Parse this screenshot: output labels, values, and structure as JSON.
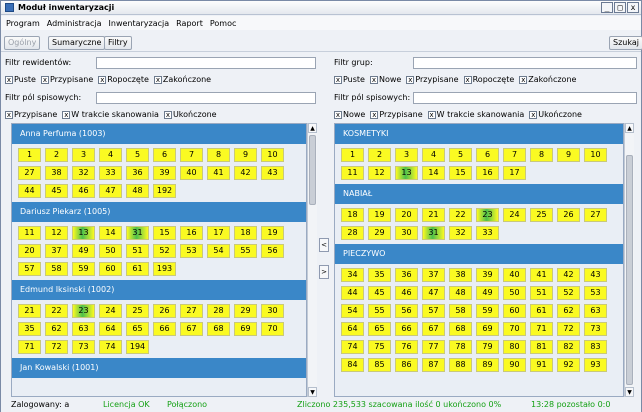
{
  "window": {
    "title": "Moduł inwentaryzacji",
    "controls": [
      "_",
      "□",
      "x"
    ]
  },
  "menu": [
    "Program",
    "Administracja",
    "Inwentaryzacja",
    "Raport",
    "Pomoc"
  ],
  "toolbar": {
    "ogolny": "Ogólny",
    "sumaryczne": "Sumaryczne",
    "filtry": "Filtry",
    "szukaj": "Szukaj"
  },
  "left_filters": {
    "reviewer_label": "Filtr rewidentów:",
    "reviewer_value": "",
    "status_checks": [
      "Puste",
      "Przypisane",
      "Ropoczęte",
      "Zakończone"
    ],
    "fields_label": "Filtr pól spisowych:",
    "fields_value": "",
    "field_checks": [
      "Przypisane",
      "W trakcie skanowania",
      "Ukończone"
    ]
  },
  "right_filters": {
    "group_label": "Filtr grup:",
    "group_value": "",
    "status_checks": [
      "Puste",
      "Nowe",
      "Przypisane",
      "Ropoczęte",
      "Zakończone"
    ],
    "fields_label": "Filtr pól spisowych:",
    "fields_value": "",
    "field_checks": [
      "Nowe",
      "Przypisane",
      "W trakcie skanowania",
      "Ukończone"
    ]
  },
  "checkbox_glyph": "x",
  "left_groups": [
    {
      "name": "Anna Perfuma (1003)",
      "cells": [
        {
          "n": "1"
        },
        {
          "n": "2"
        },
        {
          "n": "3"
        },
        {
          "n": "4"
        },
        {
          "n": "5"
        },
        {
          "n": "6"
        },
        {
          "n": "7"
        },
        {
          "n": "8"
        },
        {
          "n": "9"
        },
        {
          "n": "10"
        },
        {
          "n": "27"
        },
        {
          "n": "38"
        },
        {
          "n": "32"
        },
        {
          "n": "33"
        },
        {
          "n": "36"
        },
        {
          "n": "39"
        },
        {
          "n": "40"
        },
        {
          "n": "41"
        },
        {
          "n": "42"
        },
        {
          "n": "43"
        },
        {
          "n": "44"
        },
        {
          "n": "45"
        },
        {
          "n": "46"
        },
        {
          "n": "47"
        },
        {
          "n": "48"
        },
        {
          "n": "192"
        }
      ]
    },
    {
      "name": "Dariusz Piekarz (1005)",
      "cells": [
        {
          "n": "11"
        },
        {
          "n": "12"
        },
        {
          "n": "13",
          "done": true
        },
        {
          "n": "14"
        },
        {
          "n": "31",
          "done": true
        },
        {
          "n": "15"
        },
        {
          "n": "16"
        },
        {
          "n": "17"
        },
        {
          "n": "18"
        },
        {
          "n": "19"
        },
        {
          "n": "20"
        },
        {
          "n": "37"
        },
        {
          "n": "49"
        },
        {
          "n": "50"
        },
        {
          "n": "51"
        },
        {
          "n": "52"
        },
        {
          "n": "53"
        },
        {
          "n": "54"
        },
        {
          "n": "55"
        },
        {
          "n": "56"
        },
        {
          "n": "57"
        },
        {
          "n": "58"
        },
        {
          "n": "59"
        },
        {
          "n": "60"
        },
        {
          "n": "61"
        },
        {
          "n": "193"
        }
      ]
    },
    {
      "name": "Edmund Iksinski (1002)",
      "cells": [
        {
          "n": "21"
        },
        {
          "n": "22"
        },
        {
          "n": "23",
          "done": true
        },
        {
          "n": "24"
        },
        {
          "n": "25"
        },
        {
          "n": "26"
        },
        {
          "n": "27"
        },
        {
          "n": "28"
        },
        {
          "n": "29"
        },
        {
          "n": "30"
        },
        {
          "n": "35"
        },
        {
          "n": "62"
        },
        {
          "n": "63"
        },
        {
          "n": "64"
        },
        {
          "n": "65"
        },
        {
          "n": "66"
        },
        {
          "n": "67"
        },
        {
          "n": "68"
        },
        {
          "n": "69"
        },
        {
          "n": "70"
        },
        {
          "n": "71"
        },
        {
          "n": "72"
        },
        {
          "n": "73"
        },
        {
          "n": "74"
        },
        {
          "n": "194"
        }
      ]
    },
    {
      "name": "Jan Kowalski (1001)",
      "cells": []
    }
  ],
  "right_groups": [
    {
      "name": "KOSMETYKI",
      "cells": [
        {
          "n": "1"
        },
        {
          "n": "2"
        },
        {
          "n": "3"
        },
        {
          "n": "4"
        },
        {
          "n": "5"
        },
        {
          "n": "6"
        },
        {
          "n": "7"
        },
        {
          "n": "8"
        },
        {
          "n": "9"
        },
        {
          "n": "10"
        },
        {
          "n": "11"
        },
        {
          "n": "12"
        },
        {
          "n": "13",
          "done": true
        },
        {
          "n": "14"
        },
        {
          "n": "15"
        },
        {
          "n": "16"
        },
        {
          "n": "17"
        }
      ]
    },
    {
      "name": "NABIAŁ",
      "cells": [
        {
          "n": "18"
        },
        {
          "n": "19"
        },
        {
          "n": "20"
        },
        {
          "n": "21"
        },
        {
          "n": "22"
        },
        {
          "n": "23",
          "done": true
        },
        {
          "n": "24"
        },
        {
          "n": "25"
        },
        {
          "n": "26"
        },
        {
          "n": "27"
        },
        {
          "n": "28"
        },
        {
          "n": "29"
        },
        {
          "n": "30"
        },
        {
          "n": "31",
          "done": true
        },
        {
          "n": "32"
        },
        {
          "n": "33"
        }
      ]
    },
    {
      "name": "PIECZYWO",
      "cells": [
        {
          "n": "34"
        },
        {
          "n": "35"
        },
        {
          "n": "36"
        },
        {
          "n": "37"
        },
        {
          "n": "38"
        },
        {
          "n": "39"
        },
        {
          "n": "40"
        },
        {
          "n": "41"
        },
        {
          "n": "42"
        },
        {
          "n": "43"
        },
        {
          "n": "44"
        },
        {
          "n": "45"
        },
        {
          "n": "46"
        },
        {
          "n": "47"
        },
        {
          "n": "48"
        },
        {
          "n": "49"
        },
        {
          "n": "50"
        },
        {
          "n": "51"
        },
        {
          "n": "52"
        },
        {
          "n": "53"
        },
        {
          "n": "54"
        },
        {
          "n": "55"
        },
        {
          "n": "56"
        },
        {
          "n": "57"
        },
        {
          "n": "58"
        },
        {
          "n": "59"
        },
        {
          "n": "60"
        },
        {
          "n": "61"
        },
        {
          "n": "62"
        },
        {
          "n": "63"
        },
        {
          "n": "64"
        },
        {
          "n": "65"
        },
        {
          "n": "66"
        },
        {
          "n": "67"
        },
        {
          "n": "68"
        },
        {
          "n": "69"
        },
        {
          "n": "70"
        },
        {
          "n": "71"
        },
        {
          "n": "72"
        },
        {
          "n": "73"
        },
        {
          "n": "74"
        },
        {
          "n": "75"
        },
        {
          "n": "76"
        },
        {
          "n": "77"
        },
        {
          "n": "78"
        },
        {
          "n": "79"
        },
        {
          "n": "80"
        },
        {
          "n": "81"
        },
        {
          "n": "82"
        },
        {
          "n": "83"
        },
        {
          "n": "84"
        },
        {
          "n": "85"
        },
        {
          "n": "86"
        },
        {
          "n": "87"
        },
        {
          "n": "88"
        },
        {
          "n": "89"
        },
        {
          "n": "90"
        },
        {
          "n": "91"
        },
        {
          "n": "92"
        },
        {
          "n": "93"
        }
      ]
    }
  ],
  "mid_buttons": {
    "left": "<",
    "right": ">"
  },
  "status": {
    "user": "Zalogowany: a",
    "license": "Licencja OK",
    "connection": "Połączono",
    "summary": "Zliczono 235,533 szacowana ilość 0 ukończono 0%",
    "time": "13:28 pozostało 0:0"
  },
  "colors": {
    "header": "#3a87c8",
    "cell": "#fafa22",
    "done": "#4cc04c",
    "status_green": "#14a014"
  }
}
